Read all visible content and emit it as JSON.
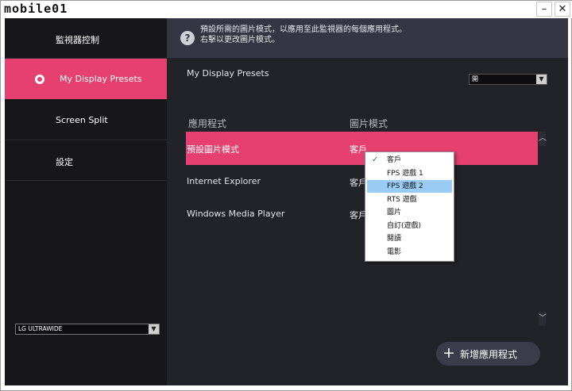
{
  "titlebar": {
    "logo": "mobile01",
    "minimize": "–",
    "close": "✕"
  },
  "sidebar": {
    "items": [
      {
        "label": "監視器控制"
      },
      {
        "label": "My Display Presets"
      },
      {
        "label": "Screen Split"
      },
      {
        "label": "設定"
      }
    ],
    "monitor": "LG ULTRAWIDE",
    "monitor_arrow": "▼"
  },
  "info": {
    "icon": "question-icon",
    "icon_glyph": "?",
    "line1": "預設所需的圖片模式，以應用至此監視器的每個應用程式。",
    "line2": "右擊以更改圖片模式。"
  },
  "main": {
    "title": "My Display Presets",
    "toggle_value": "開",
    "toggle_arrow": "▼",
    "col_app": "應用程式",
    "col_mode": "圖片模式",
    "rows": [
      {
        "app": "預設圖片模式",
        "mode": "客戶"
      },
      {
        "app": "Internet Explorer",
        "mode": "客戶"
      },
      {
        "app": "Windows Media Player",
        "mode": "客戶"
      }
    ],
    "scroll_up": "︿",
    "scroll_down": "﹀",
    "add_button": {
      "icon": "plus-icon",
      "glyph": "+",
      "label": "新增應用程式"
    }
  },
  "dropdown": {
    "items": [
      "客戶",
      "FPS 遊戲 1",
      "FPS 遊戲 2",
      "RTS 遊戲",
      "圖片",
      "自訂(遊戲)",
      "閱讀",
      "電影"
    ],
    "checked_index": 0,
    "hover_index": 2,
    "check_glyph": "✓"
  },
  "colors": {
    "accent": "#e5406f",
    "sidebar": "#16161b",
    "panel": "#222229",
    "header": "#353544",
    "hover": "#99ccf4"
  }
}
